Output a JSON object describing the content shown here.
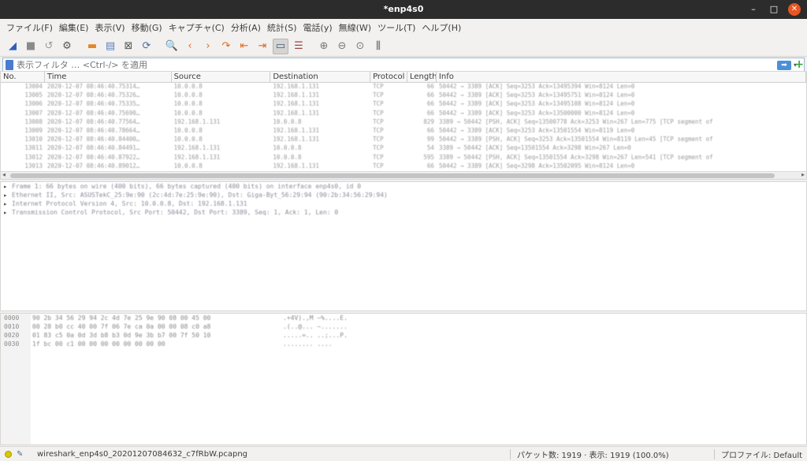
{
  "window": {
    "title": "*enp4s0",
    "minimize": "–",
    "maximize": "□",
    "close": "✕"
  },
  "menu": [
    "ファイル(F)",
    "編集(E)",
    "表示(V)",
    "移動(G)",
    "キャプチャ(C)",
    "分析(A)",
    "統計(S)",
    "電話(y)",
    "無線(W)",
    "ツール(T)",
    "ヘルプ(H)"
  ],
  "toolbar": [
    {
      "icon": "shark-fin-start-icon",
      "glyph": "◢",
      "color": "#2f5fb8"
    },
    {
      "icon": "stop-icon",
      "glyph": "■",
      "color": "#8a8a8a"
    },
    {
      "icon": "restart-icon",
      "glyph": "↺",
      "color": "#9a9a9a"
    },
    {
      "icon": "capture-options-icon",
      "glyph": "⚙",
      "color": "#555555"
    },
    {
      "sep": true
    },
    {
      "icon": "open-folder-icon",
      "glyph": "▬",
      "color": "#e0882a"
    },
    {
      "icon": "save-file-icon",
      "glyph": "▤",
      "color": "#5a7fbf"
    },
    {
      "icon": "close-file-icon",
      "glyph": "⊠",
      "color": "#555555"
    },
    {
      "icon": "reload-icon",
      "glyph": "⟳",
      "color": "#4a6ea0"
    },
    {
      "sep": true
    },
    {
      "icon": "find-icon",
      "glyph": "🔍",
      "color": "#3a5a8a"
    },
    {
      "icon": "go-back-icon",
      "glyph": "‹",
      "color": "#e06a20"
    },
    {
      "icon": "go-forward-icon",
      "glyph": "›",
      "color": "#e06a20"
    },
    {
      "icon": "go-to-packet-icon",
      "glyph": "↷",
      "color": "#e06a20"
    },
    {
      "icon": "first-packet-icon",
      "glyph": "⇤",
      "color": "#e06a20"
    },
    {
      "icon": "last-packet-icon",
      "glyph": "⇥",
      "color": "#e06a20"
    },
    {
      "icon": "autoscroll-icon",
      "glyph": "▭",
      "color": "#3a5a8a",
      "active": true
    },
    {
      "icon": "colorize-icon",
      "glyph": "☰",
      "color": "#a04040"
    },
    {
      "sep": true
    },
    {
      "icon": "zoom-in-icon",
      "glyph": "⊕",
      "color": "#777777"
    },
    {
      "icon": "zoom-out-icon",
      "glyph": "⊖",
      "color": "#777777"
    },
    {
      "icon": "zoom-normal-icon",
      "glyph": "⊙",
      "color": "#777777"
    },
    {
      "icon": "resize-columns-icon",
      "glyph": "⫼",
      "color": "#555555"
    }
  ],
  "filter": {
    "placeholder": "表示フィルタ … <Ctrl-/> を適用",
    "apply": "➡",
    "dropdown": "▾",
    "add": "+"
  },
  "packet_list": {
    "columns": [
      "No.",
      "Time",
      "Source",
      "Destination",
      "Protocol",
      "Length",
      "Info"
    ],
    "rows": [
      [
        "13004",
        "2020-12-07 08:46:40.75314…",
        "10.0.0.8",
        "192.168.1.131",
        "TCP",
        "66",
        "50442 → 3389 [ACK] Seq=3253 Ack=13495394 Win=8124 Len=0"
      ],
      [
        "13005",
        "2020-12-07 08:46:40.75326…",
        "10.0.0.8",
        "192.168.1.131",
        "TCP",
        "66",
        "50442 → 3389 [ACK] Seq=3253 Ack=13495751 Win=8124 Len=0"
      ],
      [
        "13006",
        "2020-12-07 08:46:40.75335…",
        "10.0.0.8",
        "192.168.1.131",
        "TCP",
        "66",
        "50442 → 3389 [ACK] Seq=3253 Ack=13495108 Win=8124 Len=0"
      ],
      [
        "13007",
        "2020-12-07 08:46:40.75690…",
        "10.0.0.8",
        "192.168.1.131",
        "TCP",
        "66",
        "50442 → 3389 [ACK] Seq=3253 Ack=13500000 Win=8124 Len=0"
      ],
      [
        "13008",
        "2020-12-07 08:46:40.77564…",
        "192.168.1.131",
        "10.0.0.8",
        "TCP",
        "829",
        "3389 → 50442 [PSH, ACK] Seq=13500778 Ack=3253 Win=267 Len=775 [TCP segment of"
      ],
      [
        "13009",
        "2020-12-07 08:46:40.78664…",
        "10.0.0.8",
        "192.168.1.131",
        "TCP",
        "66",
        "50442 → 3389 [ACK] Seq=3253 Ack=13501554 Win=8119 Len=0"
      ],
      [
        "13010",
        "2020-12-07 08:46:40.84400…",
        "10.0.0.8",
        "192.168.1.131",
        "TCP",
        "99",
        "50442 → 3389 [PSH, ACK] Seq=3253 Ack=13501554 Win=8119 Len=45 [TCP segment of"
      ],
      [
        "13011",
        "2020-12-07 08:46:40.84491…",
        "192.168.1.131",
        "10.0.0.8",
        "TCP",
        "54",
        "3389 → 50442 [ACK] Seq=13501554 Ack=3298 Win=267 Len=0"
      ],
      [
        "13012",
        "2020-12-07 08:46:40.87922…",
        "192.168.1.131",
        "10.0.0.8",
        "TCP",
        "595",
        "3389 → 50442 [PSH, ACK] Seq=13501554 Ack=3298 Win=267 Len=541 [TCP segment of"
      ],
      [
        "13013",
        "2020-12-07 08:46:40.89012…",
        "10.0.0.8",
        "192.168.1.131",
        "TCP",
        "66",
        "50442 → 3389 [ACK] Seq=3298 Ack=13502095 Win=8124 Len=0"
      ]
    ]
  },
  "packet_detail": [
    "Frame 1: 66 bytes on wire (400 bits), 66 bytes captured (400 bits) on interface enp4s0, id 0",
    "Ethernet II, Src: ASUSTekC_25:9e:90 (2c:4d:7e:25:9e:90), Dst: Giga-Byt_56:29:94 (90:2b:34:56:29:94)",
    "Internet Protocol Version 4, Src: 10.0.0.8, Dst: 192.168.1.131",
    "Transmission Control Protocol, Src Port: 50442, Dst Port: 3389, Seq: 1, Ack: 1, Len: 0"
  ],
  "hex": [
    {
      "offset": "0000",
      "bytes": "90 2b 34 56 29 94 2c 4d  7e 25 9e 90 08 00 45 00",
      "ascii": ".+4V).,M ~%....E."
    },
    {
      "offset": "0010",
      "bytes": "00 28 b0 cc 40 00 7f 06  7e ca 0a 00 00 08 c0 a8",
      "ascii": ".(..@... ~......."
    },
    {
      "offset": "0020",
      "bytes": "01 83 c5 0a 0d 3d b8 b3  0d 9e 3b b7 00 7f 50 10",
      "ascii": ".....=.. ..;...P."
    },
    {
      "offset": "0030",
      "bytes": "1f bc 00 c1 00 00 00 00  00 00 00 00",
      "ascii": "........ ...."
    }
  ],
  "status": {
    "file": "wireshark_enp4s0_20201207084632_c7fRbW.pcapng",
    "packets": "パケット数: 1919 · 表示: 1919 (100.0%)",
    "profile": "プロファイル: Default"
  }
}
